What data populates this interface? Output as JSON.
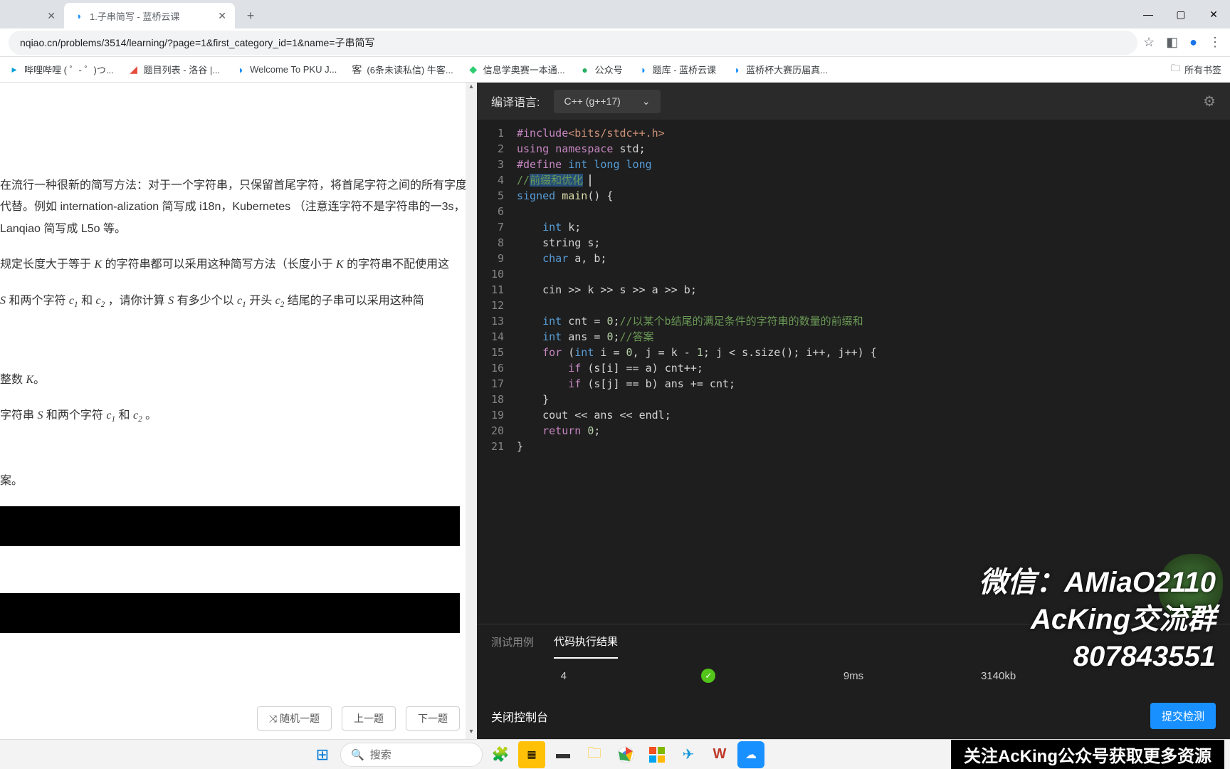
{
  "browser": {
    "tabs": [
      {
        "title": "",
        "active": false
      },
      {
        "title": "1.子串简写 - 蓝桥云课",
        "active": true
      }
    ],
    "url": "nqiao.cn/problems/3514/learning/?page=1&first_category_id=1&name=子串简写",
    "bookmarks": [
      "哔哩哔哩 ( ゜- ゜)つ...",
      "题目列表 - 洛谷 |...",
      "Welcome To PKU J...",
      "(6条未读私信) 牛客...",
      "信息学奥赛一本通...",
      "公众号",
      "题库 - 蓝桥云课",
      "蓝桥杯大赛历届真..."
    ],
    "bookmarks_folder": "所有书签"
  },
  "problem": {
    "p1": "在流行一种很新的简写方法：对于一个字符串，只保留首尾字符，将首尾字符之间的所有字度代替。例如 internation-alization 简写成 i18n，Kubernetes （注意连字符不是字符串的一3s，Lanqiao 简写成 L5o 等。",
    "p2_a": "规定长度大于等于 ",
    "p2_b": " 的字符串都可以采用这种简写方法（长度小于 ",
    "p2_c": " 的字符串不配使用这",
    "p3_a": " 和两个字符 ",
    "p3_b": " 和 ",
    "p3_c": "，请你计算 ",
    "p3_d": " 有多少个以 ",
    "p3_e": " 开头 ",
    "p3_f": " 结尾的子串可以采用这种简",
    "p4_a": "整数 ",
    "p4_b": "。",
    "p5_a": "字符串 ",
    "p5_b": " 和两个字符 ",
    "p5_c": " 和 ",
    "p5_d": "。",
    "p6": "案。",
    "nav": {
      "random": "随机一题",
      "prev": "上一题",
      "next": "下一题"
    }
  },
  "editor": {
    "lang_label": "编译语言:",
    "lang_value": "C++ (g++17)",
    "code_tokens": [
      [
        {
          "t": "#include",
          "c": "tk-include"
        },
        {
          "t": "<bits/stdc++.h>",
          "c": "tk-include-path"
        }
      ],
      [
        {
          "t": "using ",
          "c": "tk-keyword"
        },
        {
          "t": "namespace ",
          "c": "tk-keyword"
        },
        {
          "t": "std;",
          "c": ""
        }
      ],
      [
        {
          "t": "#define ",
          "c": "tk-include"
        },
        {
          "t": "int ",
          "c": "tk-type"
        },
        {
          "t": "long ",
          "c": "tk-type"
        },
        {
          "t": "long",
          "c": "tk-type"
        }
      ],
      [
        {
          "t": "//",
          "c": "tk-comment"
        },
        {
          "t": "前缀和优化",
          "c": "tk-comment tk-selected"
        }
      ],
      [
        {
          "t": "signed ",
          "c": "tk-type"
        },
        {
          "t": "main",
          "c": "tk-func"
        },
        {
          "t": "() {",
          "c": ""
        }
      ],
      [
        {
          "t": "",
          "c": ""
        }
      ],
      [
        {
          "t": "    ",
          "c": ""
        },
        {
          "t": "int ",
          "c": "tk-type"
        },
        {
          "t": "k;",
          "c": ""
        }
      ],
      [
        {
          "t": "    string s;",
          "c": ""
        }
      ],
      [
        {
          "t": "    ",
          "c": ""
        },
        {
          "t": "char ",
          "c": "tk-type"
        },
        {
          "t": "a, b;",
          "c": ""
        }
      ],
      [
        {
          "t": "",
          "c": ""
        }
      ],
      [
        {
          "t": "    cin >> k >> s >> a >> b;",
          "c": ""
        }
      ],
      [
        {
          "t": "",
          "c": ""
        }
      ],
      [
        {
          "t": "    ",
          "c": ""
        },
        {
          "t": "int ",
          "c": "tk-type"
        },
        {
          "t": "cnt = ",
          "c": ""
        },
        {
          "t": "0",
          "c": "tk-number"
        },
        {
          "t": ";",
          "c": ""
        },
        {
          "t": "//以某个b结尾的满足条件的字符串的数量的前缀和",
          "c": "tk-comment"
        }
      ],
      [
        {
          "t": "    ",
          "c": ""
        },
        {
          "t": "int ",
          "c": "tk-type"
        },
        {
          "t": "ans = ",
          "c": ""
        },
        {
          "t": "0",
          "c": "tk-number"
        },
        {
          "t": ";",
          "c": ""
        },
        {
          "t": "//答案",
          "c": "tk-comment"
        }
      ],
      [
        {
          "t": "    ",
          "c": ""
        },
        {
          "t": "for ",
          "c": "tk-keyword"
        },
        {
          "t": "(",
          "c": ""
        },
        {
          "t": "int ",
          "c": "tk-type"
        },
        {
          "t": "i = ",
          "c": ""
        },
        {
          "t": "0",
          "c": "tk-number"
        },
        {
          "t": ", j = k - ",
          "c": ""
        },
        {
          "t": "1",
          "c": "tk-number"
        },
        {
          "t": "; j < s.size(); i++, j++) {",
          "c": ""
        }
      ],
      [
        {
          "t": "        ",
          "c": ""
        },
        {
          "t": "if ",
          "c": "tk-keyword"
        },
        {
          "t": "(s[i] == a) cnt++;",
          "c": ""
        }
      ],
      [
        {
          "t": "        ",
          "c": ""
        },
        {
          "t": "if ",
          "c": "tk-keyword"
        },
        {
          "t": "(s[j] == b) ans += cnt;",
          "c": ""
        }
      ],
      [
        {
          "t": "    }",
          "c": ""
        }
      ],
      [
        {
          "t": "    cout << ans << endl;",
          "c": ""
        }
      ],
      [
        {
          "t": "    ",
          "c": ""
        },
        {
          "t": "return ",
          "c": "tk-keyword"
        },
        {
          "t": "0",
          "c": "tk-number"
        },
        {
          "t": ";",
          "c": ""
        }
      ],
      [
        {
          "t": "}",
          "c": ""
        }
      ]
    ],
    "tabs": {
      "test": "测试用例",
      "result": "代码执行结果"
    },
    "result": {
      "idx": "4",
      "time": "9ms",
      "mem": "3140kb"
    },
    "close_console": "关闭控制台",
    "submit": "提交检测"
  },
  "overlay": {
    "l1": "微信：AMiaO2110",
    "l2": "AcKing交流群",
    "l3": "807843551"
  },
  "taskbar": {
    "search_placeholder": "搜索",
    "right_text": "关注AcKing公众号获取更多资源"
  }
}
